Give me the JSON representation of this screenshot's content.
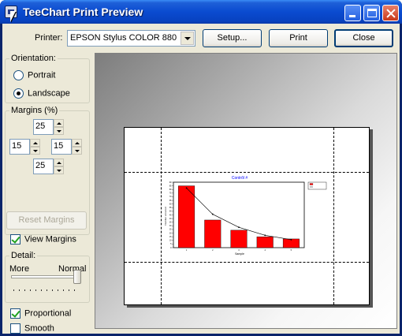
{
  "window": {
    "title": "TeeChart Print Preview"
  },
  "toolbar": {
    "printer_label": "Printer:",
    "printer_value": "EPSON Stylus COLOR 880",
    "setup_label": "Setup...",
    "print_label": "Print",
    "close_label": "Close"
  },
  "orientation": {
    "title": "Orientation:",
    "portrait_label": "Portrait",
    "landscape_label": "Landscape",
    "selected": "Landscape"
  },
  "margins": {
    "title": "Margins (%)",
    "top": "25",
    "left": "15",
    "right": "15",
    "bottom": "25",
    "reset_label": "Reset Margins",
    "view_label": "View Margins",
    "view_checked": true
  },
  "detail": {
    "title": "Detail:",
    "more_label": "More",
    "normal_label": "Normal",
    "slider_level": 1.0
  },
  "options": {
    "proportional_label": "Proportional",
    "proportional_checked": true,
    "smooth_label": "Smooth",
    "smooth_checked": false
  },
  "colors": {
    "bar_fill": "#ff0000",
    "title_blue": "#0000ff",
    "titlebar": "#0a4bd0"
  },
  "chart_data": {
    "type": "bar",
    "title": "Contrôl #",
    "categories": [
      "1",
      "2",
      "3",
      "4",
      "5"
    ],
    "series": [
      {
        "values": [
          85,
          38,
          24,
          15,
          12
        ]
      },
      {
        "values": [
          82,
          46,
          28,
          17,
          11
        ]
      }
    ],
    "ylim": [
      0,
      90
    ],
    "ylabel": "Number occurred",
    "xlabel": "Sample",
    "legend_position": "top-right"
  }
}
